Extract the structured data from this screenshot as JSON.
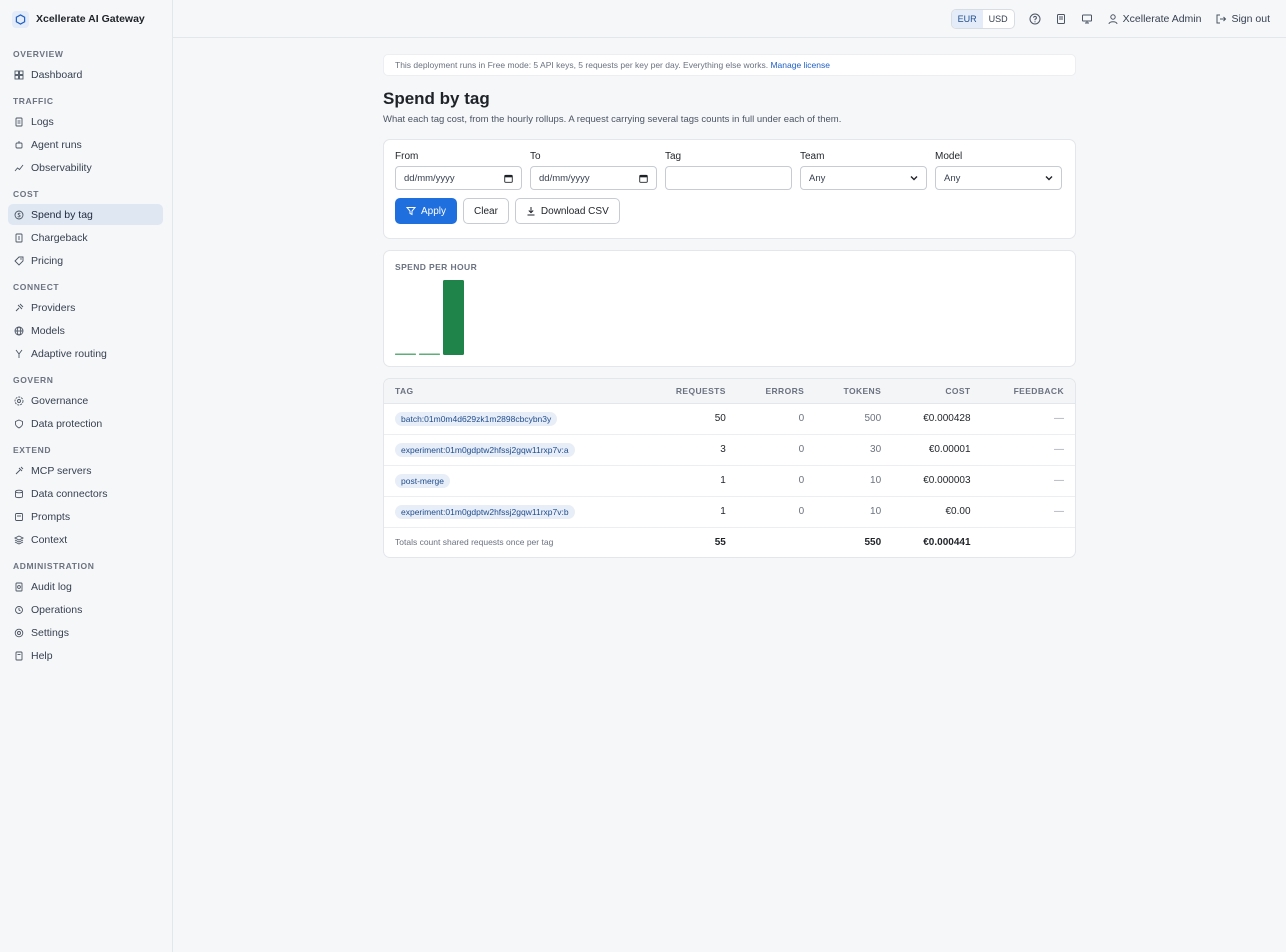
{
  "app": {
    "name": "Xcellerate AI Gateway"
  },
  "sidebar": {
    "sections": [
      {
        "heading": "OVERVIEW",
        "items": [
          {
            "label": "Dashboard",
            "icon": "dashboard-icon"
          }
        ]
      },
      {
        "heading": "TRAFFIC",
        "items": [
          {
            "label": "Logs",
            "icon": "logs-icon"
          },
          {
            "label": "Agent runs",
            "icon": "agent-icon"
          },
          {
            "label": "Observability",
            "icon": "observability-icon"
          }
        ]
      },
      {
        "heading": "COST",
        "items": [
          {
            "label": "Spend by tag",
            "icon": "spend-icon",
            "active": true
          },
          {
            "label": "Chargeback",
            "icon": "chargeback-icon"
          },
          {
            "label": "Pricing",
            "icon": "pricing-icon"
          }
        ]
      },
      {
        "heading": "CONNECT",
        "items": [
          {
            "label": "Providers",
            "icon": "providers-icon"
          },
          {
            "label": "Models",
            "icon": "models-icon"
          },
          {
            "label": "Adaptive routing",
            "icon": "routing-icon"
          }
        ]
      },
      {
        "heading": "GOVERN",
        "items": [
          {
            "label": "Governance",
            "icon": "governance-icon"
          },
          {
            "label": "Data protection",
            "icon": "shield-icon"
          }
        ]
      },
      {
        "heading": "EXTEND",
        "items": [
          {
            "label": "MCP servers",
            "icon": "mcp-icon"
          },
          {
            "label": "Data connectors",
            "icon": "database-icon"
          },
          {
            "label": "Prompts",
            "icon": "prompts-icon"
          },
          {
            "label": "Context",
            "icon": "context-icon"
          }
        ]
      },
      {
        "heading": "ADMINISTRATION",
        "items": [
          {
            "label": "Audit log",
            "icon": "audit-icon"
          },
          {
            "label": "Operations",
            "icon": "operations-icon"
          },
          {
            "label": "Settings",
            "icon": "settings-icon"
          },
          {
            "label": "Help",
            "icon": "help-book-icon"
          }
        ]
      }
    ]
  },
  "topbar": {
    "currency_options": [
      "EUR",
      "USD"
    ],
    "currency_selected": "EUR",
    "user": "Xcellerate Admin",
    "sign_out": "Sign out"
  },
  "banner": {
    "text": "This deployment runs in Free mode: 5 API keys, 5 requests per key per day. Everything else works.",
    "link": "Manage license"
  },
  "page": {
    "title": "Spend by tag",
    "subtitle": "What each tag cost, from the hourly rollups. A request carrying several tags counts in full under each of them."
  },
  "filters": {
    "from_label": "From",
    "from_placeholder": "dd/mm/yyyy",
    "to_label": "To",
    "to_placeholder": "dd/mm/yyyy",
    "tag_label": "Tag",
    "tag_value": "",
    "team_label": "Team",
    "team_value": "Any",
    "model_label": "Model",
    "model_value": "Any",
    "apply": "Apply",
    "clear": "Clear",
    "download": "Download CSV"
  },
  "chart_data": {
    "type": "bar",
    "title": "SPEND PER HOUR",
    "categories": [
      "",
      "",
      ""
    ],
    "values": [
      3e-06,
      3e-06,
      0.000428
    ],
    "ylim": [
      0,
      0.000428
    ],
    "color": "#1e8449"
  },
  "table": {
    "columns": [
      "TAG",
      "REQUESTS",
      "ERRORS",
      "TOKENS",
      "COST",
      "FEEDBACK"
    ],
    "rows": [
      {
        "tag": "batch:01m0m4d629zk1m2898cbcybn3y",
        "requests": "50",
        "errors": "0",
        "tokens": "500",
        "cost": "€0.000428",
        "feedback": "—"
      },
      {
        "tag": "experiment:01m0gdptw2hfssj2gqw11rxp7v:a",
        "requests": "3",
        "errors": "0",
        "tokens": "30",
        "cost": "€0.00001",
        "feedback": "—"
      },
      {
        "tag": "post-merge",
        "requests": "1",
        "errors": "0",
        "tokens": "10",
        "cost": "€0.000003",
        "feedback": "—"
      },
      {
        "tag": "experiment:01m0gdptw2hfssj2gqw11rxp7v:b",
        "requests": "1",
        "errors": "0",
        "tokens": "10",
        "cost": "€0.00",
        "feedback": "—"
      }
    ],
    "totals": {
      "note": "Totals count shared requests once per tag",
      "requests": "55",
      "tokens": "550",
      "cost": "€0.000441"
    }
  }
}
